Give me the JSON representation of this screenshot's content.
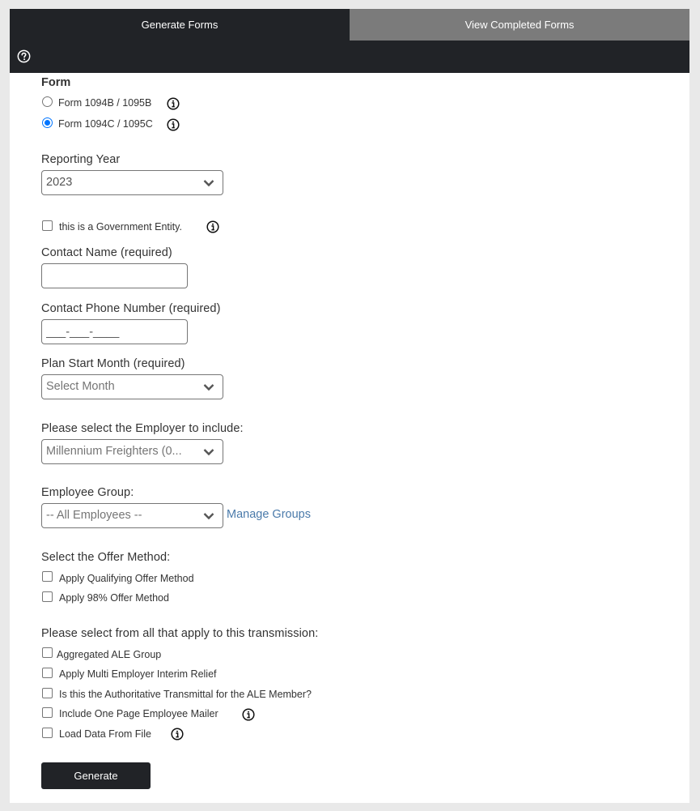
{
  "tabs": [
    {
      "label": "Generate Forms"
    },
    {
      "label": "View Completed Forms"
    }
  ],
  "form": {
    "form_label": "Form",
    "options": [
      {
        "label": "Form 1094B / 1095B",
        "checked": false
      },
      {
        "label": "Form 1094C / 1095C",
        "checked": true
      }
    ],
    "reporting_year": {
      "label": "Reporting Year",
      "value": "2023"
    },
    "government_entity": {
      "label": "this is a Government Entity.",
      "checked": false
    },
    "contact_name": {
      "label": "Contact Name (required)",
      "value": ""
    },
    "contact_phone": {
      "label": "Contact Phone Number (required)",
      "placeholder": "___-___-____"
    },
    "plan_start_month": {
      "label": "Plan Start Month (required)",
      "value": "Select Month"
    },
    "employer": {
      "label": "Please select the Employer to include:",
      "value": "Millennium Freighters (0..."
    },
    "employee_group": {
      "label": "Employee Group:",
      "value": "-- All Employees --",
      "manage_link": "Manage Groups"
    },
    "offer_method": {
      "label": "Select the Offer Method:",
      "options": [
        {
          "label": "Apply Qualifying Offer Method",
          "checked": false
        },
        {
          "label": "Apply 98% Offer Method",
          "checked": false
        }
      ]
    },
    "transmission": {
      "label": "Please select from all that apply to this transmission:",
      "options": [
        {
          "label": "Aggregated ALE Group",
          "checked": false
        },
        {
          "label": "Apply Multi Employer Interim Relief",
          "checked": false
        },
        {
          "label": "Is this the Authoritative Transmittal for the ALE Member?",
          "checked": false
        },
        {
          "label": "Include One Page Employee Mailer",
          "checked": false
        },
        {
          "label": "Load Data From File",
          "checked": false
        }
      ]
    },
    "generate_button": "Generate"
  },
  "colors": {
    "header_dark": "#212327",
    "tab_inactive": "#7b7b7b",
    "link": "#4a7aaa",
    "radio_accent": "#0075ff"
  }
}
